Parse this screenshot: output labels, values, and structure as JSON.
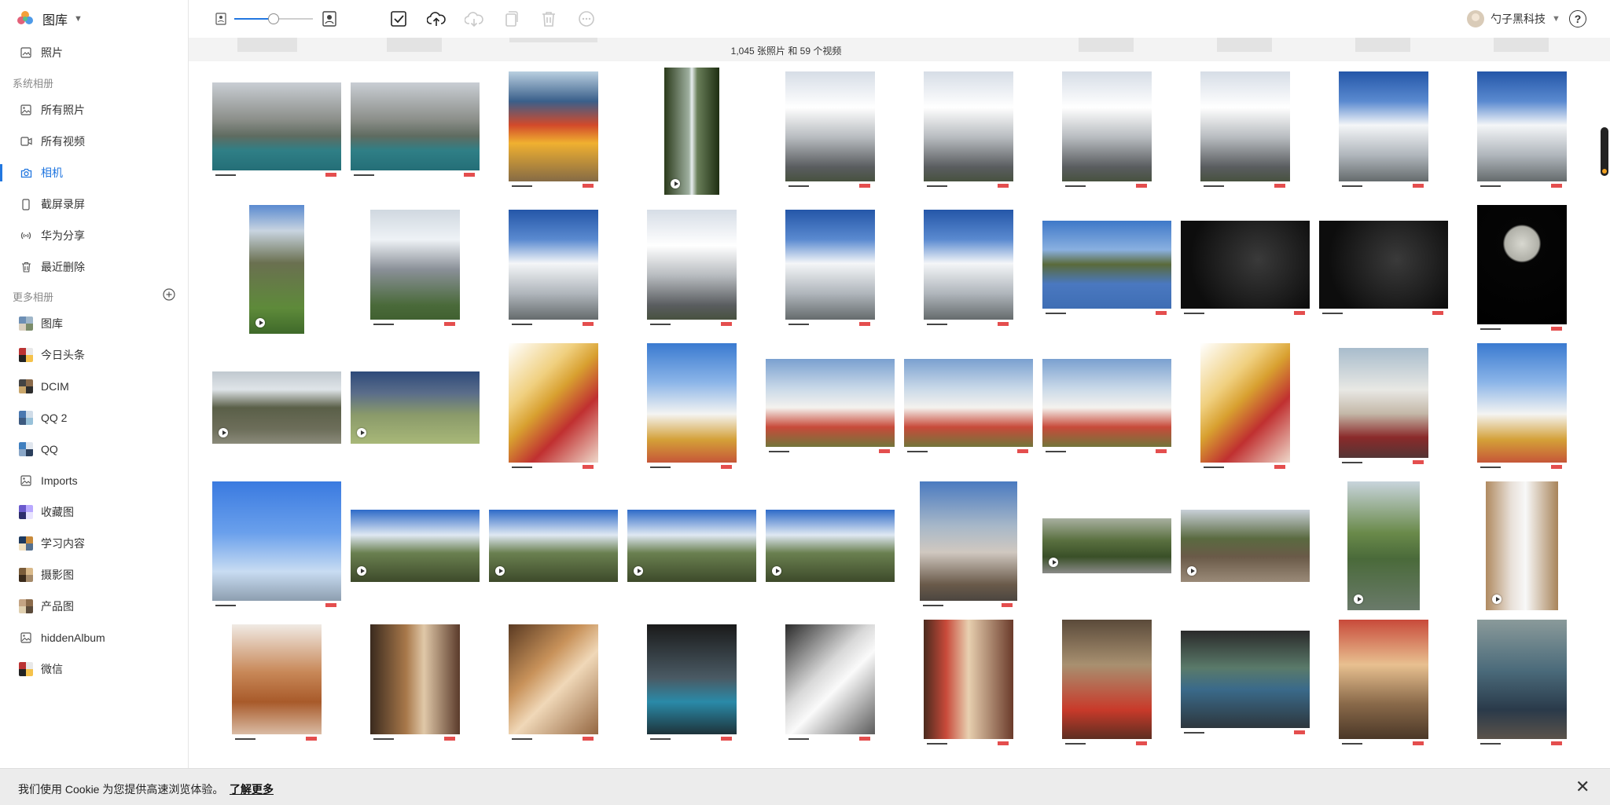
{
  "app": {
    "title": "图库"
  },
  "sidebar": {
    "top_item": {
      "label": "照片",
      "icon": "photo-icon"
    },
    "system_section": "系统相册",
    "system_items": [
      {
        "label": "所有照片",
        "icon": "image-icon"
      },
      {
        "label": "所有视频",
        "icon": "video-icon"
      },
      {
        "label": "相机",
        "icon": "camera-icon",
        "active": true
      },
      {
        "label": "截屏录屏",
        "icon": "phone-icon"
      },
      {
        "label": "华为分享",
        "icon": "share-icon"
      },
      {
        "label": "最近删除",
        "icon": "trash-icon"
      }
    ],
    "more_section": "更多相册",
    "more_items": [
      {
        "label": "图库",
        "icon": "album-thumb"
      },
      {
        "label": "今日头条",
        "icon": "album-thumb"
      },
      {
        "label": "DCIM",
        "icon": "album-thumb"
      },
      {
        "label": "QQ 2",
        "icon": "album-thumb"
      },
      {
        "label": "QQ",
        "icon": "album-thumb"
      },
      {
        "label": "Imports",
        "icon": "image-icon"
      },
      {
        "label": "收藏图",
        "icon": "album-thumb"
      },
      {
        "label": "学习内容",
        "icon": "album-thumb"
      },
      {
        "label": "摄影图",
        "icon": "album-thumb"
      },
      {
        "label": "产品图",
        "icon": "album-thumb"
      },
      {
        "label": "hiddenAlbum",
        "icon": "image-icon"
      },
      {
        "label": "微信",
        "icon": "album-thumb"
      }
    ]
  },
  "toolbar": {
    "zoom_level": 0.5,
    "buttons": [
      "select-icon",
      "upload-icon",
      "download-icon",
      "copy-icon",
      "delete-icon",
      "more-icon"
    ]
  },
  "user": {
    "name": "勺子黑科技"
  },
  "content": {
    "count_text": "1,045 张照片 和 59 个视频"
  },
  "cookie": {
    "text": "我们使用 Cookie 为您提供高速浏览体验。",
    "link": "了解更多"
  },
  "colors": {
    "accent": "#2277e0",
    "cookie_bg": "#ececec"
  },
  "photos": [
    [
      {
        "kind": "lake"
      },
      {
        "kind": "lake"
      },
      {
        "kind": "prayer"
      },
      {
        "kind": "waterfall",
        "video": true
      },
      {
        "kind": "snow"
      },
      {
        "kind": "snow"
      },
      {
        "kind": "snow"
      },
      {
        "kind": "snow"
      },
      {
        "kind": "snowblue"
      },
      {
        "kind": "snowblue"
      }
    ],
    [
      {
        "kind": "trail",
        "video": true
      },
      {
        "kind": "valley"
      },
      {
        "kind": "snowblue"
      },
      {
        "kind": "snow"
      },
      {
        "kind": "snowblue"
      },
      {
        "kind": "snowblue"
      },
      {
        "kind": "plaza"
      },
      {
        "kind": "night"
      },
      {
        "kind": "night"
      },
      {
        "kind": "moon"
      }
    ],
    [
      {
        "kind": "hill",
        "video": true
      },
      {
        "kind": "meadow",
        "video": true
      },
      {
        "kind": "stupa"
      },
      {
        "kind": "stupablue"
      },
      {
        "kind": "stupas"
      },
      {
        "kind": "stupas"
      },
      {
        "kind": "stupas"
      },
      {
        "kind": "stupa"
      },
      {
        "kind": "crowd"
      },
      {
        "kind": "stupablue"
      }
    ],
    [
      {
        "kind": "sign"
      },
      {
        "kind": "clouds",
        "video": true
      },
      {
        "kind": "clouds",
        "video": true
      },
      {
        "kind": "clouds",
        "video": true
      },
      {
        "kind": "clouds",
        "video": true
      },
      {
        "kind": "sculpture"
      },
      {
        "kind": "road",
        "video": true
      },
      {
        "kind": "deck",
        "video": true
      },
      {
        "kind": "pond",
        "video": true
      },
      {
        "kind": "product",
        "video": true
      }
    ],
    [
      {
        "kind": "perfume"
      },
      {
        "kind": "interior"
      },
      {
        "kind": "curves"
      },
      {
        "kind": "dark"
      },
      {
        "kind": "bw"
      },
      {
        "kind": "alley"
      },
      {
        "kind": "wall"
      },
      {
        "kind": "market"
      },
      {
        "kind": "cafe"
      },
      {
        "kind": "tricycle"
      }
    ]
  ]
}
